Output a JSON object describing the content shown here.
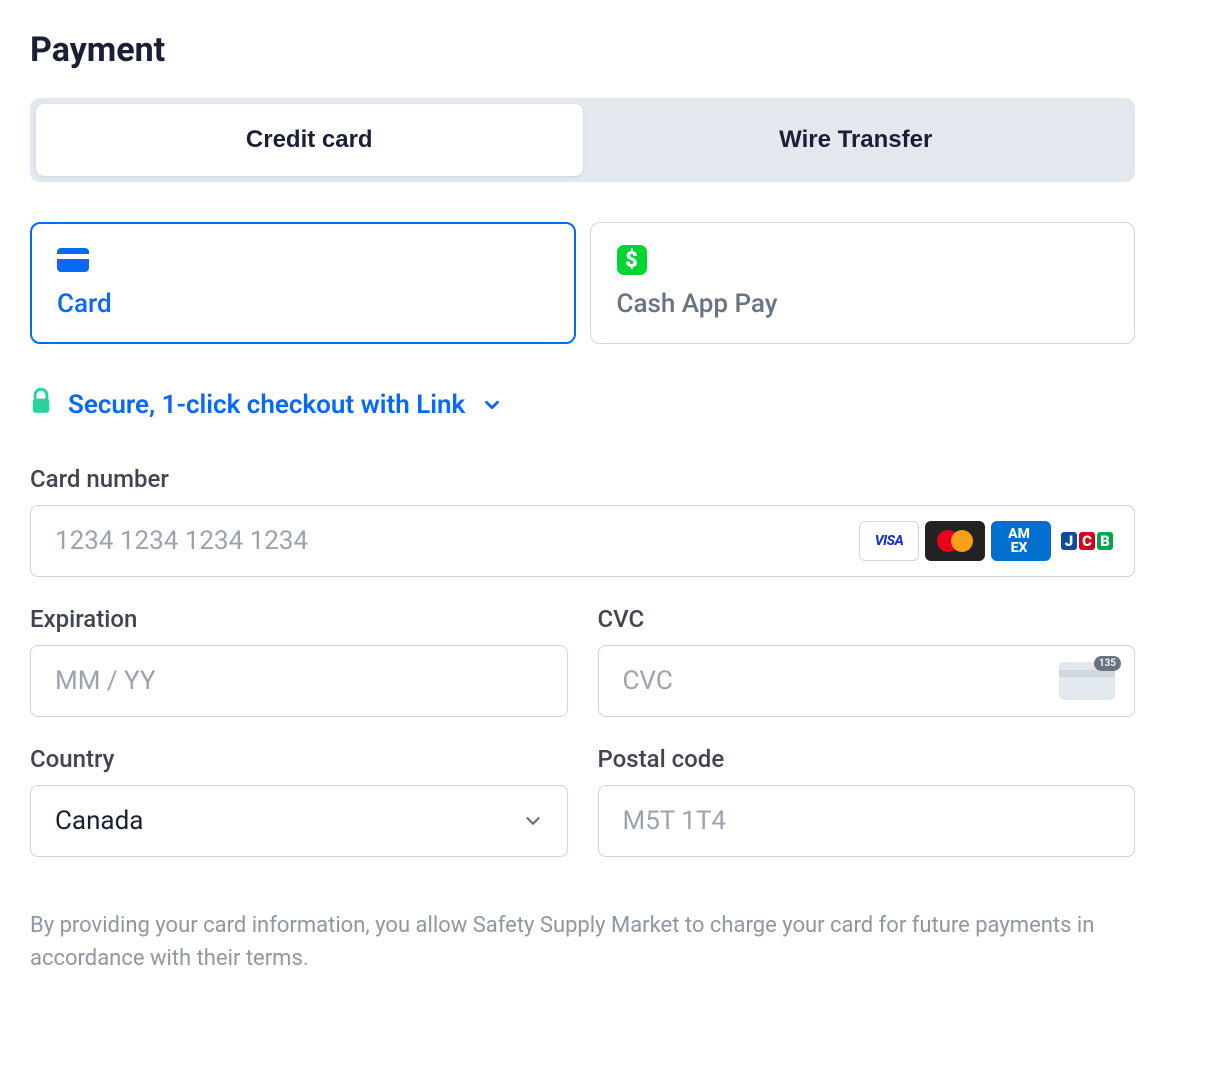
{
  "title": "Payment",
  "payment_type_tabs": {
    "credit_card": "Credit card",
    "wire_transfer": "Wire Transfer"
  },
  "methods": {
    "card": "Card",
    "cashapp": "Cash App Pay"
  },
  "link_banner": {
    "text": "Secure, 1-click checkout with Link"
  },
  "fields": {
    "card_number": {
      "label": "Card number",
      "placeholder": "1234 1234 1234 1234"
    },
    "expiration": {
      "label": "Expiration",
      "placeholder": "MM / YY"
    },
    "cvc": {
      "label": "CVC",
      "placeholder": "CVC",
      "hint_digits": "135"
    },
    "country": {
      "label": "Country",
      "value": "Canada"
    },
    "postal": {
      "label": "Postal code",
      "placeholder": "M5T 1T4"
    }
  },
  "card_brands": {
    "visa": "VISA",
    "amex_line1": "AM",
    "amex_line2": "EX",
    "jcb_j": "J",
    "jcb_c": "C",
    "jcb_b": "B"
  },
  "disclaimer": "By providing your card information, you allow Safety Supply Market to charge your card for future payments in accordance with their terms."
}
